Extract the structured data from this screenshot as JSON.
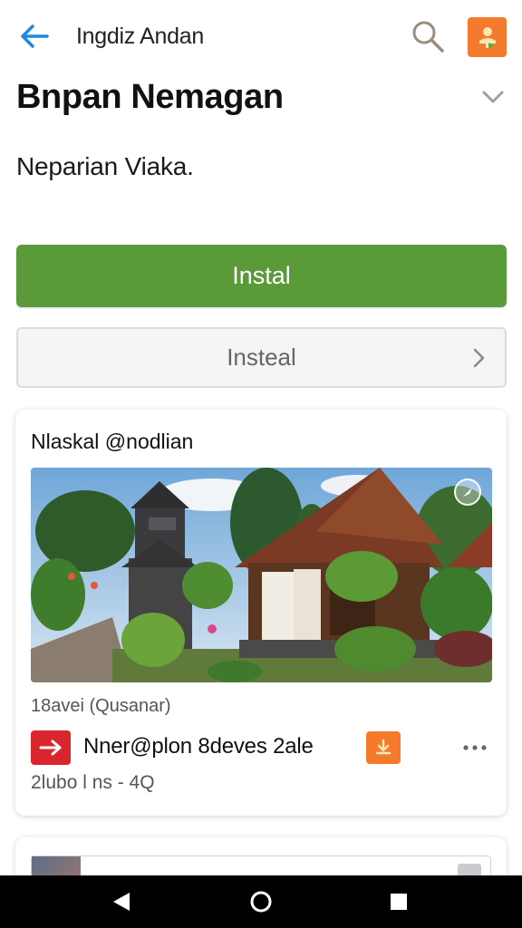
{
  "header": {
    "app_name": "Ingdiz Andan",
    "back_icon": "arrow-left-icon",
    "search_icon": "search-icon",
    "share_icon": "share-icon"
  },
  "page": {
    "title": "Bnpan Nemagan",
    "subtitle": "Neparian Viaka.",
    "expand_icon": "chevron-down-icon"
  },
  "buttons": {
    "install_primary": "Instal",
    "install_secondary": "Insteal"
  },
  "card": {
    "header": "Nlaskal @nodlian",
    "meta": "18avei (Qusanar)",
    "item_label": "Nner@plon 8deves 2ale",
    "footer": "2lubo l ns - 4Q"
  },
  "colors": {
    "accent_green": "#5a9a38",
    "accent_orange": "#f47a2e",
    "accent_red": "#d9252e",
    "back_arrow_blue": "#1e88e5"
  }
}
